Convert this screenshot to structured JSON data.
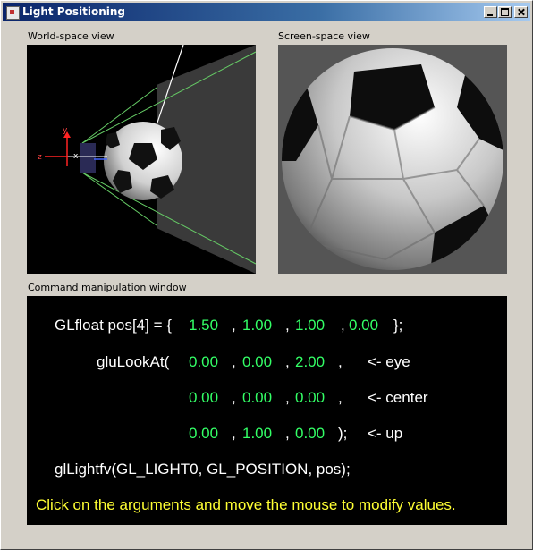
{
  "window": {
    "title": "Light Positioning"
  },
  "panels": {
    "world_label": "World-space view",
    "screen_label": "Screen-space view",
    "command_label": "Command manipulation window"
  },
  "world_view": {
    "axis_labels": {
      "x": "x",
      "y": "y",
      "z": "z"
    }
  },
  "command": {
    "pos_prefix": "GLfloat pos[4] = {",
    "pos_values": [
      "1.50",
      "1.00",
      "1.00",
      "0.00"
    ],
    "pos_suffix": "};",
    "lookat_prefix": "gluLookAt(",
    "eye_values": [
      "0.00",
      "0.00",
      "2.00"
    ],
    "eye_comment": "<- eye",
    "center_values": [
      "0.00",
      "0.00",
      "0.00"
    ],
    "center_comment": "<- center",
    "up_values": [
      "0.00",
      "1.00",
      "0.00"
    ],
    "up_close": ");",
    "up_comment": "<- up",
    "lightfv": "glLightfv(GL_LIGHT0, GL_POSITION, pos);",
    "hint": "Click on the arguments and move the mouse to modify values.",
    "comma": ",",
    "colors": {
      "text": "#ffffff",
      "value": "#33ff66",
      "hint": "#ffff33"
    }
  }
}
